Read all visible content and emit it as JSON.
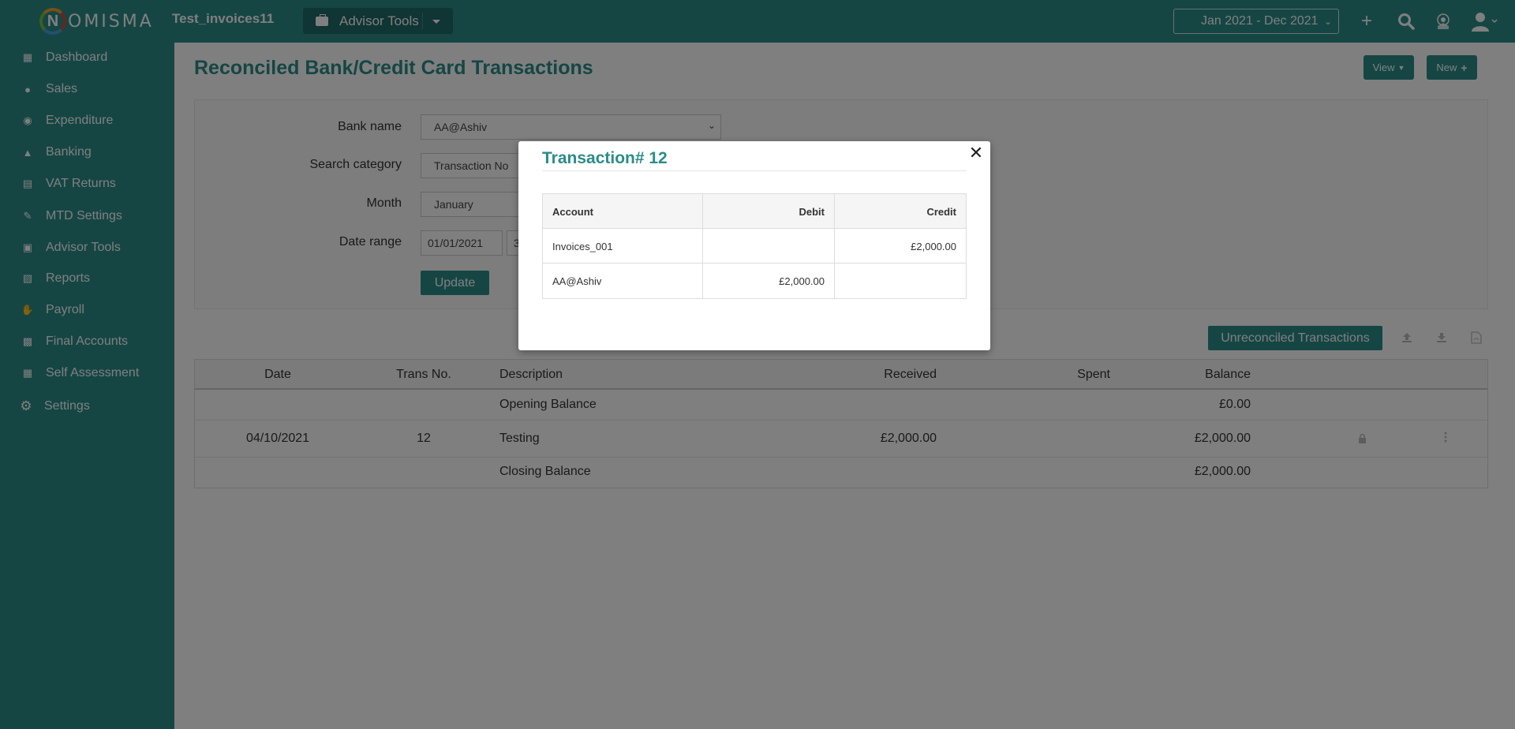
{
  "topbar": {
    "logo_initial": "N",
    "logo_rest": "OMISMA",
    "company": "Test_invoices11",
    "advisor_tools": "Advisor Tools",
    "period": "Jan 2021 - Dec 2021",
    "icons": [
      "plus-icon",
      "search-icon",
      "hmrc-crest-icon",
      "user-icon"
    ]
  },
  "sidebar": {
    "items": [
      {
        "label": "Dashboard",
        "icon": "dashboard-icon"
      },
      {
        "label": "Sales",
        "icon": "sales-icon"
      },
      {
        "label": "Expenditure",
        "icon": "money-bag-icon"
      },
      {
        "label": "Banking",
        "icon": "bank-icon"
      },
      {
        "label": "VAT Returns",
        "icon": "vat-icon"
      },
      {
        "label": "MTD Settings",
        "icon": "mtd-icon"
      },
      {
        "label": "Advisor Tools",
        "icon": "briefcase-icon"
      },
      {
        "label": "Reports",
        "icon": "report-icon"
      },
      {
        "label": "Payroll",
        "icon": "payroll-icon"
      },
      {
        "label": "Final Accounts",
        "icon": "final-accounts-icon"
      },
      {
        "label": "Self Assessment",
        "icon": "self-assessment-icon"
      },
      {
        "label": "Settings",
        "icon": "gear-icon"
      }
    ]
  },
  "page": {
    "title": "Reconciled Bank/Credit Card Transactions",
    "view_label": "View",
    "new_label": "New"
  },
  "filters": {
    "bank_name_label": "Bank name",
    "bank_name_value": "AA@Ashiv",
    "search_category_label": "Search category",
    "search_category_value": "Transaction No",
    "month_label": "Month",
    "month_value": "January",
    "date_range_label": "Date range",
    "date_from": "01/01/2021",
    "date_to_partial": "3",
    "update_label": "Update"
  },
  "actions": {
    "unreconciled_label": "Unreconciled Transactions"
  },
  "table": {
    "headers": {
      "date": "Date",
      "trans_no": "Trans No.",
      "description": "Description",
      "received": "Received",
      "spent": "Spent",
      "balance": "Balance"
    },
    "rows": [
      {
        "date": "",
        "trans_no": "",
        "description": "Opening Balance",
        "received": "",
        "spent": "",
        "balance": "£0.00"
      },
      {
        "date": "04/10/2021",
        "trans_no": "12",
        "description": "Testing",
        "received": "£2,000.00",
        "spent": "",
        "balance": "£2,000.00"
      },
      {
        "date": "",
        "trans_no": "",
        "description": "Closing Balance",
        "received": "",
        "spent": "",
        "balance": "£2,000.00"
      }
    ]
  },
  "modal": {
    "title": "Transaction# 12",
    "headers": {
      "account": "Account",
      "debit": "Debit",
      "credit": "Credit"
    },
    "rows": [
      {
        "account": "Invoices_001",
        "debit": "",
        "credit": "£2,000.00"
      },
      {
        "account": "AA@Ashiv",
        "debit": "£2,000.00",
        "credit": ""
      }
    ]
  }
}
